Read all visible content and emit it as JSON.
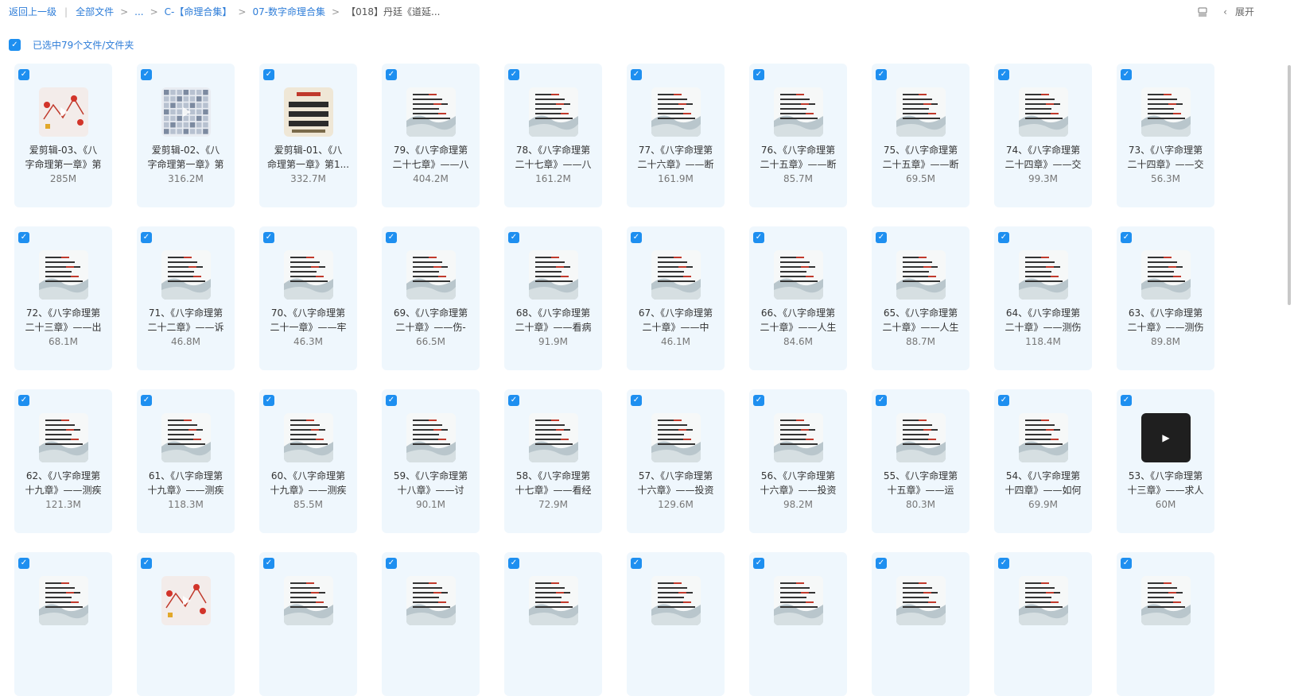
{
  "breadcrumb": {
    "back": "返回上一级",
    "all_files": "全部文件",
    "ellipsis": "...",
    "folder1": "C-【命理合集】",
    "folder2": "07-数字命理合集",
    "current": "【018】丹廷《道延..."
  },
  "toolbar": {
    "expand_label": "展开"
  },
  "selection": {
    "summary": "已选中79个文件/文件夹"
  },
  "files": [
    {
      "line1": "爱剪辑-03、《八",
      "line2": "字命理第一章》第",
      "size": "285M",
      "thumb": "red"
    },
    {
      "line1": "爱剪辑-02、《八",
      "line2": "字命理第一章》第",
      "size": "316.2M",
      "thumb": "grid"
    },
    {
      "line1": "爱剪辑-01、《八",
      "line2": "命理第一章》第1...",
      "size": "332.7M",
      "thumb": "beige"
    },
    {
      "line1": "79、《八字命理第",
      "line2": "二十七章》——八",
      "size": "404.2M",
      "thumb": "slide"
    },
    {
      "line1": "78、《八字命理第",
      "line2": "二十七章》——八",
      "size": "161.2M",
      "thumb": "slide"
    },
    {
      "line1": "77、《八字命理第",
      "line2": "二十六章》——断",
      "size": "161.9M",
      "thumb": "slide"
    },
    {
      "line1": "76、《八字命理第",
      "line2": "二十五章》——断",
      "size": "85.7M",
      "thumb": "slide"
    },
    {
      "line1": "75、《八字命理第",
      "line2": "二十五章》——断",
      "size": "69.5M",
      "thumb": "slide"
    },
    {
      "line1": "74、《八字命理第",
      "line2": "二十四章》——交",
      "size": "99.3M",
      "thumb": "slide"
    },
    {
      "line1": "73、《八字命理第",
      "line2": "二十四章》——交",
      "size": "56.3M",
      "thumb": "slide"
    },
    {
      "line1": "72、《八字命理第",
      "line2": "二十三章》——出",
      "size": "68.1M",
      "thumb": "slide"
    },
    {
      "line1": "71、《八字命理第",
      "line2": "二十二章》——诉",
      "size": "46.8M",
      "thumb": "slide"
    },
    {
      "line1": "70、《八字命理第",
      "line2": "二十一章》——牢",
      "size": "46.3M",
      "thumb": "slide"
    },
    {
      "line1": "69、《八字命理第",
      "line2": "二十章》——伤-",
      "size": "66.5M",
      "thumb": "slide"
    },
    {
      "line1": "68、《八字命理第",
      "line2": "二十章》——看病",
      "size": "91.9M",
      "thumb": "slide"
    },
    {
      "line1": "67、《八字命理第",
      "line2": "二十章》——中",
      "size": "46.1M",
      "thumb": "slide"
    },
    {
      "line1": "66、《八字命理第",
      "line2": "二十章》——人生",
      "size": "84.6M",
      "thumb": "slide"
    },
    {
      "line1": "65、《八字命理第",
      "line2": "二十章》——人生",
      "size": "88.7M",
      "thumb": "slide"
    },
    {
      "line1": "64、《八字命理第",
      "line2": "二十章》——测伤",
      "size": "118.4M",
      "thumb": "slide"
    },
    {
      "line1": "63、《八字命理第",
      "line2": "二十章》——测伤",
      "size": "89.8M",
      "thumb": "slide"
    },
    {
      "line1": "62、《八字命理第",
      "line2": "十九章》——测疾",
      "size": "121.3M",
      "thumb": "slide"
    },
    {
      "line1": "61、《八字命理第",
      "line2": "十九章》——测疾",
      "size": "118.3M",
      "thumb": "slide"
    },
    {
      "line1": "60、《八字命理第",
      "line2": "十九章》——测疾",
      "size": "85.5M",
      "thumb": "slide"
    },
    {
      "line1": "59、《八字命理第",
      "line2": "十八章》——讨",
      "size": "90.1M",
      "thumb": "slide"
    },
    {
      "line1": "58、《八字命理第",
      "line2": "十七章》——看经",
      "size": "72.9M",
      "thumb": "slide"
    },
    {
      "line1": "57、《八字命理第",
      "line2": "十六章》——投资",
      "size": "129.6M",
      "thumb": "slide"
    },
    {
      "line1": "56、《八字命理第",
      "line2": "十六章》——投资",
      "size": "98.2M",
      "thumb": "slide"
    },
    {
      "line1": "55、《八字命理第",
      "line2": "十五章》——运",
      "size": "80.3M",
      "thumb": "slide"
    },
    {
      "line1": "54、《八字命理第",
      "line2": "十四章》——如何",
      "size": "69.9M",
      "thumb": "slide"
    },
    {
      "line1": "53、《八字命理第",
      "line2": "十三章》——求人",
      "size": "60M",
      "thumb": "dark"
    },
    {
      "line1": "",
      "line2": "",
      "size": "",
      "thumb": "slide"
    },
    {
      "line1": "",
      "line2": "",
      "size": "",
      "thumb": "red"
    },
    {
      "line1": "",
      "line2": "",
      "size": "",
      "thumb": "slide"
    },
    {
      "line1": "",
      "line2": "",
      "size": "",
      "thumb": "slide"
    },
    {
      "line1": "",
      "line2": "",
      "size": "",
      "thumb": "slide"
    },
    {
      "line1": "",
      "line2": "",
      "size": "",
      "thumb": "slide"
    },
    {
      "line1": "",
      "line2": "",
      "size": "",
      "thumb": "slide"
    },
    {
      "line1": "",
      "line2": "",
      "size": "",
      "thumb": "slide"
    },
    {
      "line1": "",
      "line2": "",
      "size": "",
      "thumb": "slide"
    },
    {
      "line1": "",
      "line2": "",
      "size": "",
      "thumb": "slide"
    }
  ],
  "icons": {
    "checkbox": "check-icon",
    "play": "play-icon",
    "list_view": "list-view-icon",
    "chevron": "chevron-left-icon"
  },
  "colors": {
    "accent": "#1e8ff0",
    "link": "#2e7dd8",
    "tile_bg": "#eff7fd"
  }
}
